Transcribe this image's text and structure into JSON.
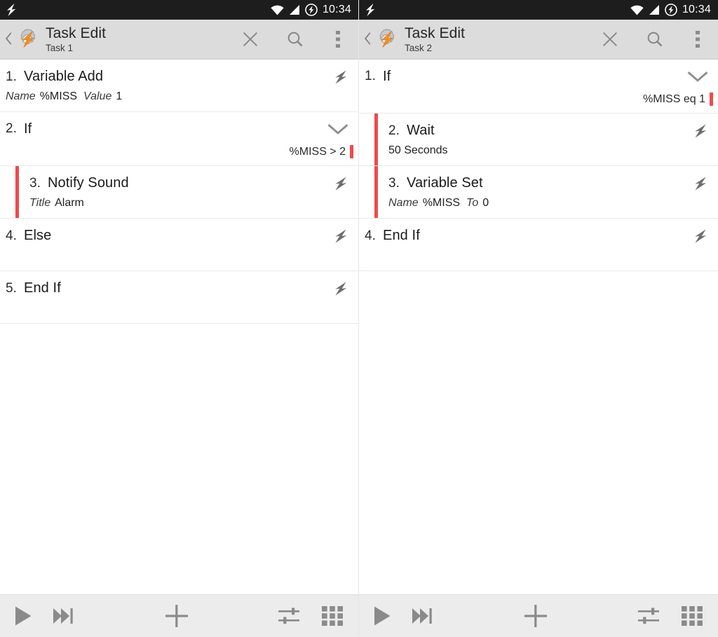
{
  "status_bar": {
    "notification_icon": "tasker-bolt-icon",
    "icons": [
      "wifi-icon",
      "cellular-signal-icon",
      "battery-charging-icon"
    ],
    "time": "10:34"
  },
  "accent_colors": {
    "indent_red": "#f2494b",
    "logo_orange": "#f29022",
    "appbar_gray": "#dcdcdc",
    "statusbar_dark": "#1d1d1d",
    "toolbar_gray": "#ececec"
  },
  "panels": [
    {
      "id": "left",
      "header": {
        "back_icon": "back-chevron-icon",
        "logo_icon": "tasker-logo-icon",
        "title": "Task Edit",
        "subtitle": "Task 1",
        "actions": [
          {
            "name": "close-button",
            "icon": "close-icon"
          },
          {
            "name": "search-button",
            "icon": "search-icon"
          },
          {
            "name": "overflow-menu-button",
            "icon": "overflow-menu-icon"
          }
        ]
      },
      "actions": [
        {
          "number": "1.",
          "name": "Variable Add",
          "indented": false,
          "right_icon": "lightning-bolt-icon",
          "params": [
            {
              "label": "Name",
              "value": "%MISS"
            },
            {
              "label": "Value",
              "value": "1"
            }
          ],
          "condition": ""
        },
        {
          "number": "2.",
          "name": "If",
          "indented": false,
          "right_icon": "chevron-down-icon",
          "params": [],
          "condition": "%MISS > 2"
        },
        {
          "number": "3.",
          "name": "Notify Sound",
          "indented": true,
          "right_icon": "lightning-bolt-icon",
          "params": [
            {
              "label": "Title",
              "value": "Alarm"
            }
          ],
          "condition": ""
        },
        {
          "number": "4.",
          "name": "Else",
          "indented": false,
          "right_icon": "lightning-bolt-icon",
          "params": [],
          "condition": ""
        },
        {
          "number": "5.",
          "name": "End If",
          "indented": false,
          "right_icon": "lightning-bolt-icon",
          "params": [],
          "condition": ""
        }
      ],
      "toolbar": [
        {
          "name": "run-task-button",
          "icon": "play-icon"
        },
        {
          "name": "step-task-button",
          "icon": "skip-next-icon"
        },
        {
          "name": "add-action-button",
          "icon": "plus-icon"
        },
        {
          "name": "task-properties-button",
          "icon": "sliders-icon"
        },
        {
          "name": "action-grid-button",
          "icon": "grid-icon"
        }
      ]
    },
    {
      "id": "right",
      "header": {
        "back_icon": "back-chevron-icon",
        "logo_icon": "tasker-logo-icon",
        "title": "Task Edit",
        "subtitle": "Task 2",
        "actions": [
          {
            "name": "close-button",
            "icon": "close-icon"
          },
          {
            "name": "search-button",
            "icon": "search-icon"
          },
          {
            "name": "overflow-menu-button",
            "icon": "overflow-menu-icon"
          }
        ]
      },
      "actions": [
        {
          "number": "1.",
          "name": "If",
          "indented": false,
          "right_icon": "chevron-down-icon",
          "params": [],
          "condition": "%MISS eq 1"
        },
        {
          "number": "2.",
          "name": "Wait",
          "indented": true,
          "right_icon": "lightning-bolt-icon",
          "params": [
            {
              "label": "",
              "value": "50 Seconds"
            }
          ],
          "condition": ""
        },
        {
          "number": "3.",
          "name": "Variable Set",
          "indented": true,
          "right_icon": "lightning-bolt-icon",
          "params": [
            {
              "label": "Name",
              "value": "%MISS"
            },
            {
              "label": "To",
              "value": "0"
            }
          ],
          "condition": ""
        },
        {
          "number": "4.",
          "name": "End If",
          "indented": false,
          "right_icon": "lightning-bolt-icon",
          "params": [],
          "condition": ""
        }
      ],
      "toolbar": [
        {
          "name": "run-task-button",
          "icon": "play-icon"
        },
        {
          "name": "step-task-button",
          "icon": "skip-next-icon"
        },
        {
          "name": "add-action-button",
          "icon": "plus-icon"
        },
        {
          "name": "task-properties-button",
          "icon": "sliders-icon"
        },
        {
          "name": "action-grid-button",
          "icon": "grid-icon"
        }
      ]
    }
  ]
}
